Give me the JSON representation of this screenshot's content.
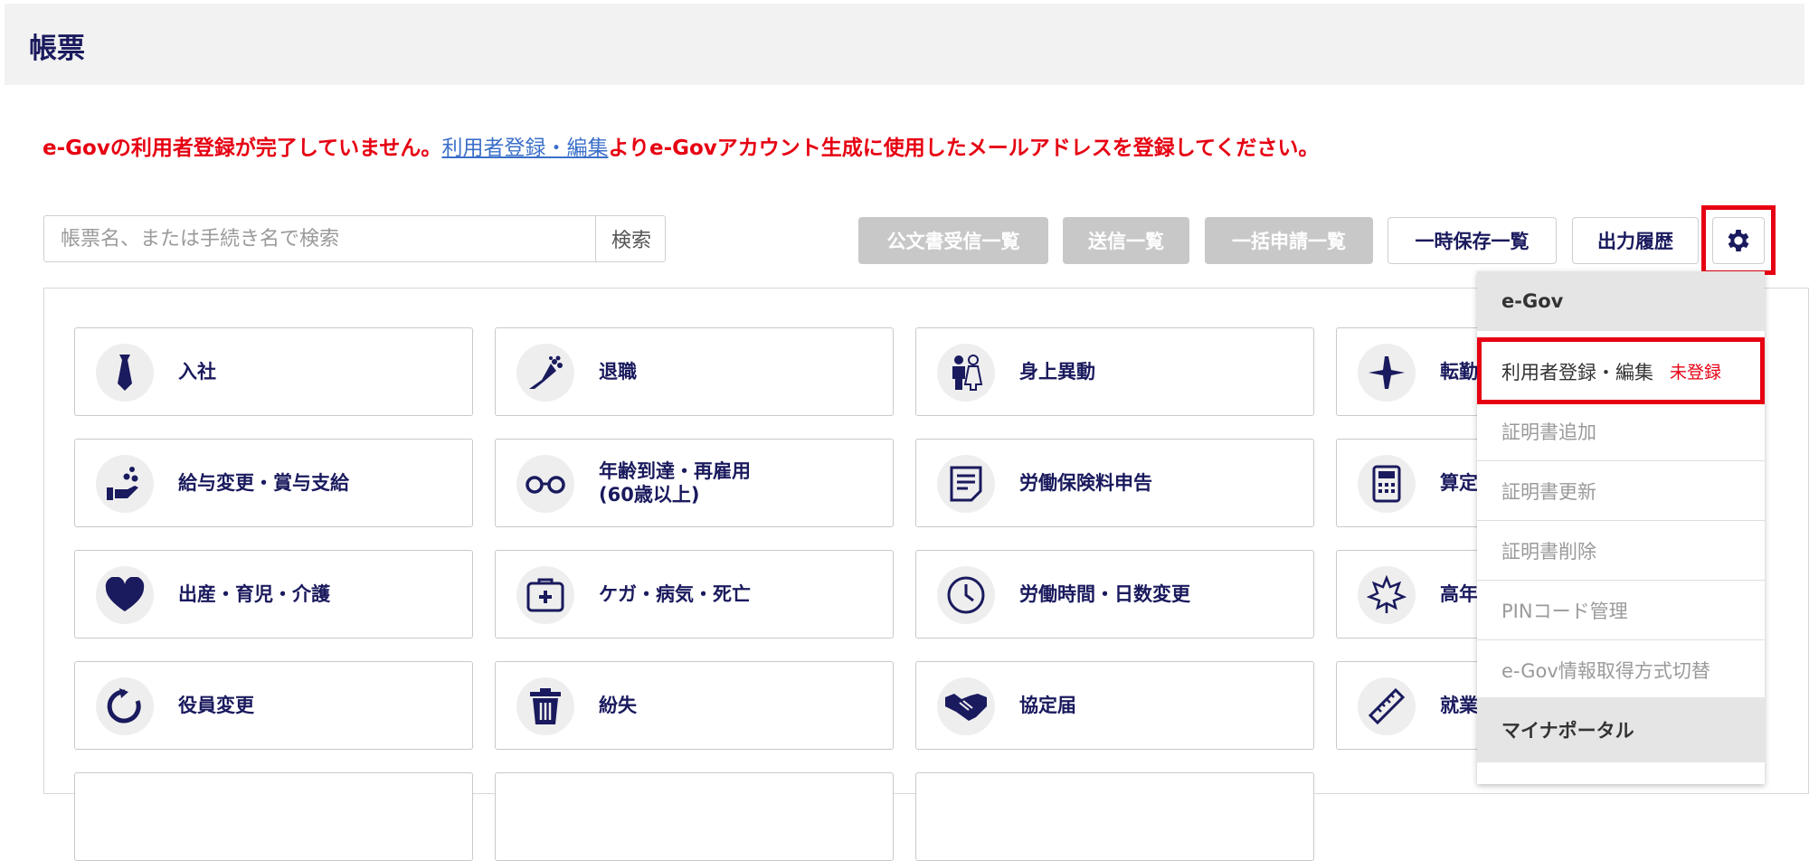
{
  "header": {
    "title": "帳票"
  },
  "warning": {
    "prefix": "e-Govの利用者登録が完了していません。",
    "link": "利用者登録・編集",
    "suffix": "よりe-Govアカウント生成に使用したメールアドレスを登録してください。"
  },
  "search": {
    "placeholder": "帳票名、または手続き名で検索",
    "button": "検索"
  },
  "toolbar": {
    "public_doc": "公文書受信一覧",
    "sent": "送信一覧",
    "bulk": "一括申請一覧",
    "temp": "一時保存一覧",
    "history": "出力履歴"
  },
  "cards": [
    {
      "label": "入社",
      "icon": "necktie-icon"
    },
    {
      "label": "退職",
      "icon": "bouquet-icon"
    },
    {
      "label": "身上異動",
      "icon": "couple-icon"
    },
    {
      "label": "転勤",
      "icon": "airplane-icon"
    },
    {
      "label": "給与変更・賞与支給",
      "icon": "hand-coins-icon"
    },
    {
      "label": "年齢到達・再雇用\n(60歳以上)",
      "icon": "glasses-icon"
    },
    {
      "label": "労働保険料申告",
      "icon": "document-icon"
    },
    {
      "label": "算定",
      "icon": "calculator-icon"
    },
    {
      "label": "出産・育児・介護",
      "icon": "heart-icon"
    },
    {
      "label": "ケガ・病気・死亡",
      "icon": "medical-kit-icon"
    },
    {
      "label": "労働時間・日数変更",
      "icon": "clock-icon"
    },
    {
      "label": "高年",
      "icon": "maple-leaf-icon"
    },
    {
      "label": "役員変更",
      "icon": "refresh-icon"
    },
    {
      "label": "紛失",
      "icon": "trash-icon"
    },
    {
      "label": "協定届",
      "icon": "handshake-icon"
    },
    {
      "label": "就業",
      "icon": "ruler-icon"
    }
  ],
  "menu": {
    "section1": "e-Gov",
    "items": [
      {
        "label": "利用者登録・編集",
        "badge": "未登録"
      },
      {
        "label": "証明書追加"
      },
      {
        "label": "証明書更新"
      },
      {
        "label": "証明書削除"
      },
      {
        "label": "PINコード管理"
      },
      {
        "label": "e-Gov情報取得方式切替"
      }
    ],
    "section2": "マイナポータル"
  },
  "colors": {
    "navy": "#1a1a5e",
    "alert_red": "#e60012",
    "link_blue": "#3b6fc9",
    "disabled_gray": "#c8c8c8"
  }
}
